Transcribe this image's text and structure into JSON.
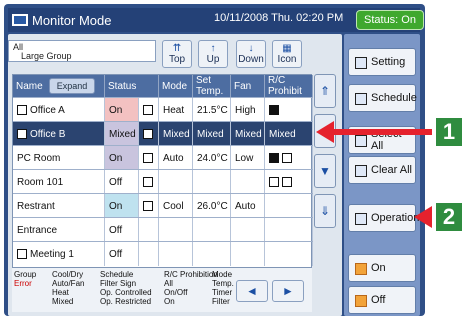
{
  "window": {
    "title": "Monitor Mode",
    "datetime": "10/11/2008 Thu. 02:20 PM",
    "status": "Status:  On"
  },
  "group": {
    "line1": "All",
    "line2": "Large Group"
  },
  "nav": [
    {
      "label": "Top"
    },
    {
      "label": "Up"
    },
    {
      "label": "Down"
    },
    {
      "label": "Icon"
    }
  ],
  "table": {
    "headers": [
      "Name",
      "Expand",
      "Status",
      "Mode",
      "Set Temp.",
      "Fan",
      "R/C Prohibit"
    ],
    "rows": [
      {
        "name": "Office A",
        "status": "On",
        "mode": "Heat",
        "temp": "21.5°C",
        "fan": "High",
        "rc": ""
      },
      {
        "name": "Office B",
        "status": "Mixed",
        "mode": "Mixed",
        "temp": "Mixed",
        "fan": "Mixed",
        "rc": "Mixed"
      },
      {
        "name": "PC Room",
        "status": "On",
        "mode": "Auto",
        "temp": "24.0°C",
        "fan": "Low",
        "rc": ""
      },
      {
        "name": "Room 101",
        "status": "Off",
        "mode": "",
        "temp": "",
        "fan": "",
        "rc": ""
      },
      {
        "name": "Restrant",
        "status": "On",
        "mode": "Cool",
        "temp": "26.0°C",
        "fan": "Auto",
        "rc": ""
      },
      {
        "name": "Entrance",
        "status": "Off",
        "mode": "",
        "temp": "",
        "fan": "",
        "rc": ""
      },
      {
        "name": "Meeting 1",
        "status": "Off",
        "mode": "",
        "temp": "",
        "fan": "",
        "rc": ""
      }
    ]
  },
  "legend": {
    "c1": [
      "Group",
      "Error"
    ],
    "c2": [
      "Cool/Dry",
      "Auto/Fan",
      "Heat",
      "Mixed"
    ],
    "c3": [
      "Schedule",
      "Filter Sign",
      "Op. Controlled",
      "Op. Restricted"
    ],
    "c4": [
      "R/C Prohibition",
      "All",
      "On/Off",
      "On"
    ],
    "c5": [
      "Mode",
      "Temp.",
      "Timer",
      "Filter"
    ]
  },
  "right": {
    "setting": "Setting",
    "schedule": "Schedule",
    "select_all": "Select All",
    "clear_all": "Clear All",
    "operation": "Operation",
    "on": "On",
    "off": "Off"
  },
  "callouts": {
    "one": "1",
    "two": "2"
  }
}
